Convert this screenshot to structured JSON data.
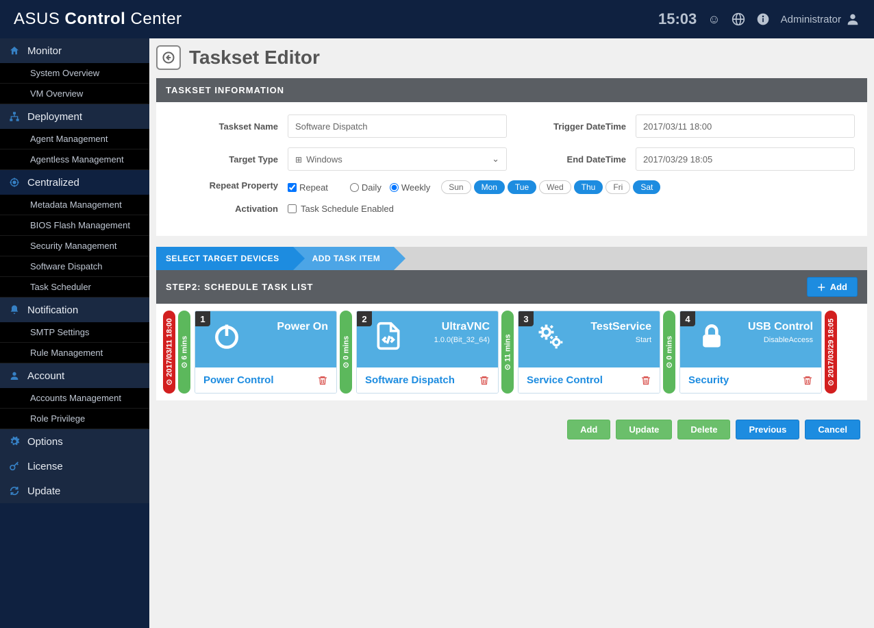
{
  "header": {
    "brand_a": "ASUS ",
    "brand_b": "Control ",
    "brand_c": "Center",
    "time": "15:03",
    "user": "Administrator"
  },
  "sidebar": {
    "sections": [
      {
        "icon": "home",
        "label": "Monitor",
        "dark": true,
        "items": [
          "System Overview",
          "VM Overview"
        ]
      },
      {
        "icon": "sitemap",
        "label": "Deployment",
        "dark": true,
        "items": [
          "Agent Management",
          "Agentless Management"
        ]
      },
      {
        "icon": "target",
        "label": "Centralized",
        "dark": false,
        "items": [
          "Metadata Management",
          "BIOS Flash Management",
          "Security Management",
          "Software Dispatch",
          "Task Scheduler"
        ]
      },
      {
        "icon": "bell",
        "label": "Notification",
        "dark": true,
        "items": [
          "SMTP Settings",
          "Rule Management"
        ]
      },
      {
        "icon": "user",
        "label": "Account",
        "dark": true,
        "items": [
          "Accounts Management",
          "Role Privilege"
        ]
      },
      {
        "icon": "gear",
        "label": "Options",
        "dark": true,
        "items": []
      },
      {
        "icon": "key",
        "label": "License",
        "dark": true,
        "items": []
      },
      {
        "icon": "refresh",
        "label": "Update",
        "dark": true,
        "items": []
      }
    ]
  },
  "page": {
    "title": "Taskset Editor",
    "info_header": "TASKSET INFORMATION",
    "form": {
      "taskset_name_label": "Taskset Name",
      "taskset_name_value": "Software Dispatch",
      "target_type_label": "Target Type",
      "target_type_value": "Windows",
      "trigger_label": "Trigger DateTime",
      "trigger_value": "2017/03/11 18:00",
      "end_label": "End DateTime",
      "end_value": "2017/03/29 18:05",
      "repeat_label": "Repeat Property",
      "repeat_checkbox": "Repeat",
      "daily": "Daily",
      "weekly": "Weekly",
      "days": [
        {
          "label": "Sun",
          "on": false
        },
        {
          "label": "Mon",
          "on": true
        },
        {
          "label": "Tue",
          "on": true
        },
        {
          "label": "Wed",
          "on": false
        },
        {
          "label": "Thu",
          "on": true
        },
        {
          "label": "Fri",
          "on": false
        },
        {
          "label": "Sat",
          "on": true
        }
      ],
      "activation_label": "Activation",
      "activation_checkbox": "Task Schedule Enabled"
    },
    "steps": {
      "s1": "SELECT TARGET DEVICES",
      "s2": "ADD TASK ITEM"
    },
    "step2_header": "STEP2: SCHEDULE TASK LIST",
    "add_button": "Add",
    "start_time": "2017/03/11 18:00",
    "end_time": "2017/03/29 18:05",
    "tasks": [
      {
        "num": "1",
        "mins": "6 mins",
        "icon": "power",
        "title": "Power On",
        "sub": "",
        "type": "Power Control"
      },
      {
        "num": "2",
        "mins": "0 mins",
        "icon": "code",
        "title": "UltraVNC",
        "sub": "1.0.0(Bit_32_64)",
        "type": "Software Dispatch"
      },
      {
        "num": "3",
        "mins": "11 mins",
        "icon": "gears",
        "title": "TestService",
        "sub": "Start",
        "type": "Service Control"
      },
      {
        "num": "4",
        "mins": "0 mins",
        "icon": "lock",
        "title": "USB Control",
        "sub": "DisableAccess",
        "type": "Security"
      }
    ],
    "buttons": {
      "add": "Add",
      "update": "Update",
      "delete": "Delete",
      "previous": "Previous",
      "cancel": "Cancel"
    }
  }
}
